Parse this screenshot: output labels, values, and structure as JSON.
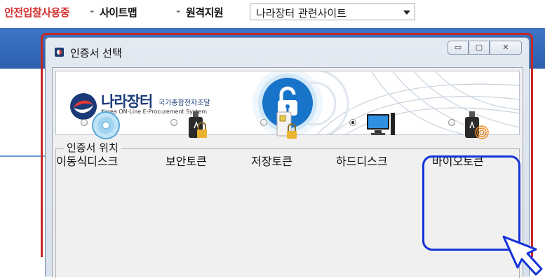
{
  "topbar": {
    "safe_bid": "안전입찰사용중",
    "sep": "-",
    "sitemap": "사이트맵",
    "remote": "원격지원",
    "site_select": "나라장터 관련사이트"
  },
  "dialog": {
    "title": "인증서 선택",
    "window_buttons": {
      "minimize": "▭",
      "maximize": "▢",
      "close": "✕"
    },
    "banner": {
      "logo_name": "나라장터",
      "logo_sub": "국가종합전자조달",
      "logo_eng": "Korea ON-Line E-Procurement System"
    },
    "location_group": "인증서 위치",
    "options": [
      {
        "label": "이동식디스크",
        "icon": "cd-disc-icon",
        "selected": false
      },
      {
        "label": "보안토큰",
        "icon": "usb-lock-icon",
        "selected": false
      },
      {
        "label": "저장토큰",
        "icon": "card-lock-icon",
        "selected": false
      },
      {
        "label": "하드디스크",
        "icon": "computer-icon",
        "selected": true
      },
      {
        "label": "바이오토큰",
        "icon": "usb-fingerprint-icon",
        "selected": false
      }
    ]
  },
  "colors": {
    "highlight": "#1433d9",
    "frame": "#c62828",
    "brand": "#1a3a78",
    "accent_red": "#d32f2f"
  }
}
